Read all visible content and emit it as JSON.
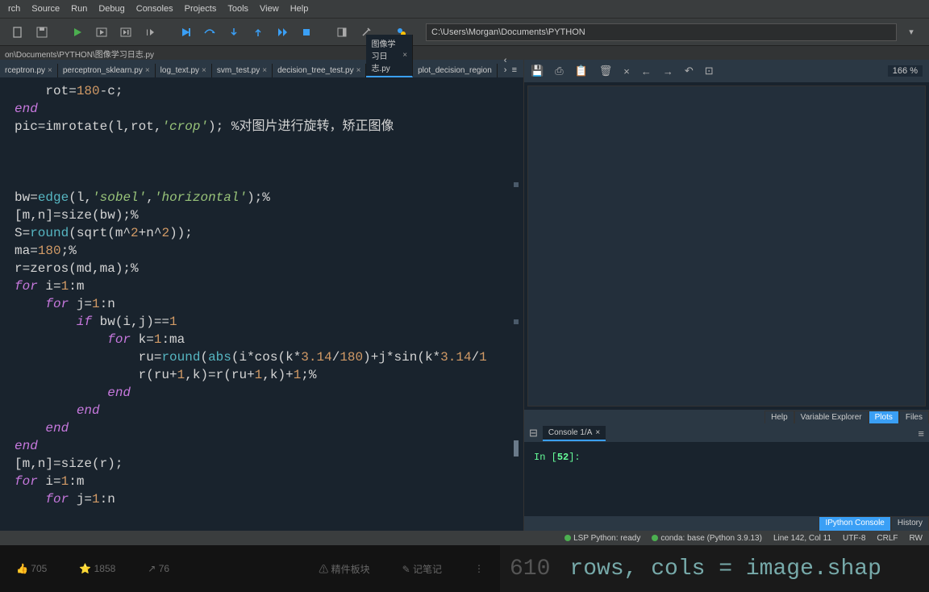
{
  "menu": [
    "rch",
    "Source",
    "Run",
    "Debug",
    "Consoles",
    "Projects",
    "Tools",
    "View",
    "Help"
  ],
  "path": "C:\\Users\\Morgan\\Documents\\PYTHON",
  "breadcrumb": "on\\Documents\\PYTHON\\图像学习日志.py",
  "tabs": [
    {
      "label": "rceptron.py",
      "active": false
    },
    {
      "label": "perceptron_sklearn.py",
      "active": false
    },
    {
      "label": "log_text.py",
      "active": false
    },
    {
      "label": "svm_test.py",
      "active": false
    },
    {
      "label": "decision_tree_test.py",
      "active": false
    },
    {
      "label": "图像学习日志.py",
      "active": true
    },
    {
      "label": "plot_decision_region",
      "active": false
    }
  ],
  "code": {
    "l1": "    rot=180-c;",
    "l2": "end",
    "l3a": "pic=imrotate(l,rot,",
    "l3b": "'crop'",
    "l3c": "); %对图片进行旋转，矫正图像",
    "l4a": "bw=",
    "l4b": "edge",
    "l4c": "(l,",
    "l4d": "'sobel'",
    "l4e": ",",
    "l4f": "'horizontal'",
    "l4g": ");%",
    "l5": "[m,n]=size(bw);%",
    "l6a": "S=",
    "l6b": "round",
    "l6c": "(sqrt(m^",
    "l6d": "2",
    "l6e": "+n^",
    "l6f": "2",
    "l6g": "));",
    "l7a": "ma=",
    "l7b": "180",
    "l7c": ";%",
    "l8": "r=zeros(md,ma);%",
    "l9a": "for",
    "l9b": " i=",
    "l9c": "1",
    "l9d": ":m",
    "l10a": "for",
    "l10b": " j=",
    "l10c": "1",
    "l10d": ":n",
    "l11a": "if",
    "l11b": " bw(i,j)==",
    "l11c": "1",
    "l12a": "for",
    "l12b": " k=",
    "l12c": "1",
    "l12d": ":ma",
    "l13a": "ru=",
    "l13b": "round",
    "l13c": "(",
    "l13d": "abs",
    "l13e": "(i*cos(k*",
    "l13f": "3.14",
    "l13g": "/",
    "l13h": "180",
    "l13i": ")+j*sin(k*",
    "l13j": "3.14",
    "l13k": "/",
    "l13l": "1",
    "l14a": "r(ru+",
    "l14b": "1",
    "l14c": ",k)=r(ru+",
    "l14d": "1",
    "l14e": ",k)+",
    "l14f": "1",
    "l14g": ";%",
    "l15": "end",
    "l16": "end",
    "l17": "end",
    "l18": "end",
    "l19": "[m,n]=size(r);",
    "l20a": "for",
    "l20b": " i=",
    "l20c": "1",
    "l20d": ":m",
    "l21a": "for",
    "l21b": " j=",
    "l21c": "1",
    "l21d": ":n"
  },
  "zoom": "166 %",
  "panel_tabs": [
    "Help",
    "Variable Explorer",
    "Plots",
    "Files"
  ],
  "panel_active": "Plots",
  "console_tab": "Console 1/A",
  "console_prompt_a": "In [",
  "console_prompt_b": "52",
  "console_prompt_c": "]:",
  "bottom_tabs": [
    "IPython Console",
    "History"
  ],
  "status": {
    "lsp": "LSP Python: ready",
    "env": "conda: base (Python 3.9.13)",
    "pos": "Line 142, Col 11",
    "enc": "UTF-8",
    "eol": "CRLF",
    "mode": "RW"
  },
  "strip": {
    "a": "705",
    "b": "1858",
    "c": "76",
    "d": "精件板块",
    "e": "记笔记"
  },
  "big": {
    "num": "610",
    "txt": "rows, cols = image.shap"
  }
}
